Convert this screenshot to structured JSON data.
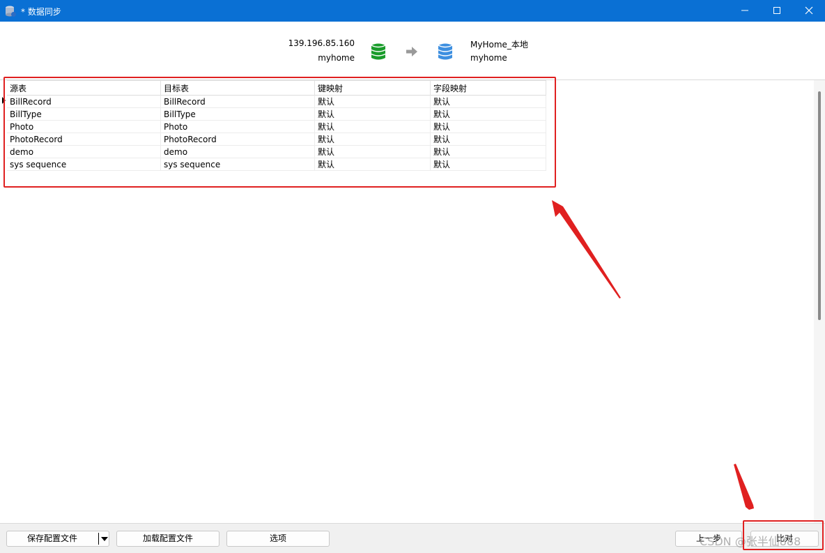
{
  "window": {
    "title": "* 数据同步"
  },
  "connection": {
    "source_host": "139.196.85.160",
    "source_db": "myhome",
    "target_host": "MyHome_本地",
    "target_db": "myhome",
    "source_color": "#1a9c2b",
    "target_color": "#3d8fe0"
  },
  "table": {
    "headers": [
      "源表",
      "目标表",
      "键映射",
      "字段映射"
    ],
    "rows": [
      [
        "BillRecord",
        "BillRecord",
        "默认",
        "默认"
      ],
      [
        "BillType",
        "BillType",
        "默认",
        "默认"
      ],
      [
        "Photo",
        "Photo",
        "默认",
        "默认"
      ],
      [
        "PhotoRecord",
        "PhotoRecord",
        "默认",
        "默认"
      ],
      [
        "demo",
        "demo",
        "默认",
        "默认"
      ],
      [
        "sys sequence",
        "sys sequence",
        "默认",
        "默认"
      ]
    ]
  },
  "footer": {
    "save_config": "保存配置文件",
    "load_config": "加载配置文件",
    "options": "选项",
    "prev": "上一步",
    "compare": "比对"
  },
  "watermark": "CSDN @张半仙888",
  "colors": {
    "titlebar": "#0a70d4",
    "annotation": "#e02020"
  }
}
